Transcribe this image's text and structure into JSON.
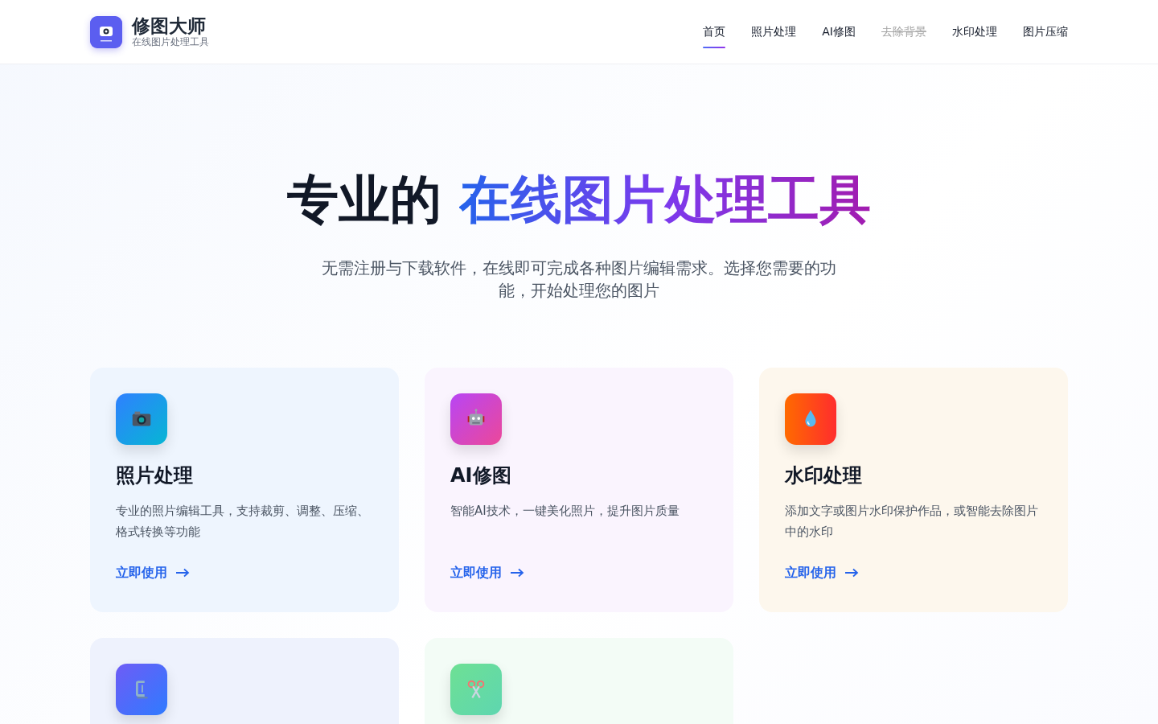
{
  "brand": {
    "name": "修图大师",
    "tagline": "在线图片处理工具"
  },
  "nav": [
    {
      "label": "首页",
      "selected": true,
      "disabled": false
    },
    {
      "label": "照片处理",
      "selected": false,
      "disabled": false
    },
    {
      "label": "AI修图",
      "selected": false,
      "disabled": false
    },
    {
      "label": "去除背景",
      "selected": false,
      "disabled": true
    },
    {
      "label": "水印处理",
      "selected": false,
      "disabled": false
    },
    {
      "label": "图片压缩",
      "selected": false,
      "disabled": false
    }
  ],
  "hero": {
    "title": "专业的",
    "title_highlight": "在线图片处理工具",
    "subtitle": "无需注册与下载软件，在线即可完成各种图片编辑需求。选择您需要的功能，开始处理您的图片"
  },
  "features": [
    {
      "kind": "camera",
      "title": "照片处理",
      "description": "专业的照片编辑工具，支持裁剪、调整、压缩、格式转换等功能",
      "link": "立即使用"
    },
    {
      "kind": "robot",
      "title": "AI修图",
      "description": "智能AI技术，一键美化照片，提升图片质量",
      "link": "立即使用"
    },
    {
      "kind": "drop",
      "title": "水印处理",
      "description": "添加文字或图片水印保护作品，或智能去除图片中的水印",
      "link": "立即使用"
    },
    {
      "kind": "clamp"
    },
    {
      "kind": "scissors"
    }
  ]
}
